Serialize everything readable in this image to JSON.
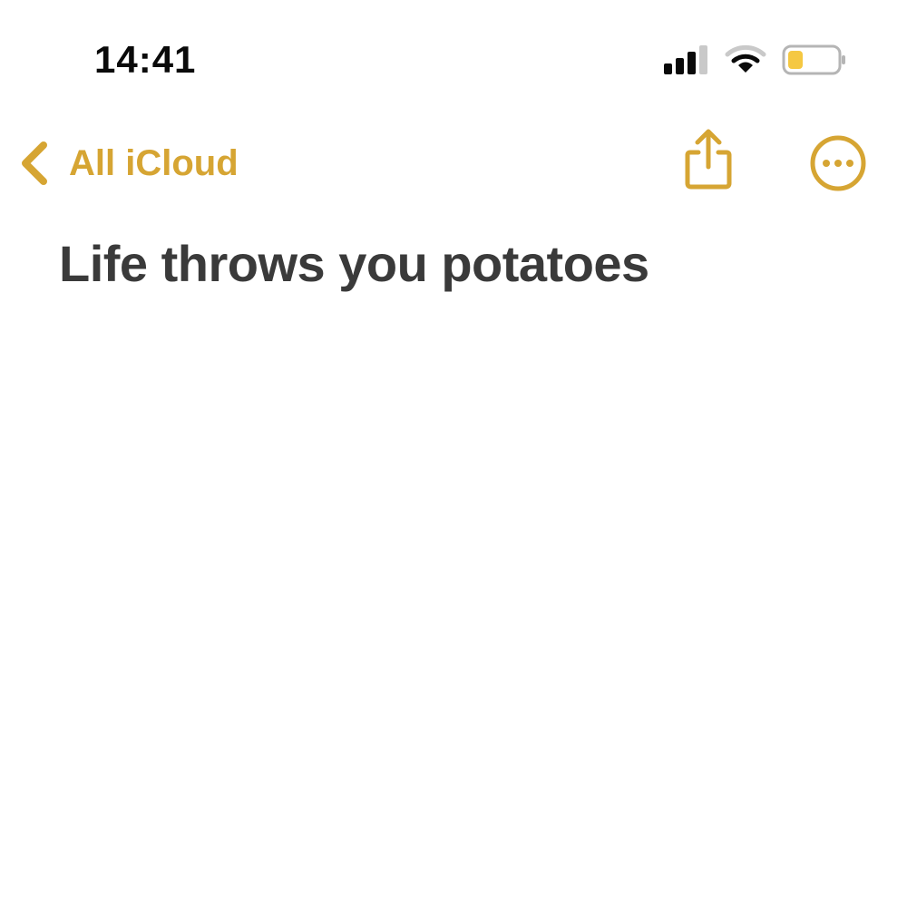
{
  "status_bar": {
    "time": "14:41",
    "signal_icon": "cellular-signal-icon",
    "wifi_icon": "wifi-icon",
    "battery_icon": "battery-low-icon",
    "battery_level": 0.3
  },
  "nav": {
    "back_label": "All iCloud",
    "back_icon": "chevron-left-icon",
    "share_icon": "share-icon",
    "more_icon": "ellipsis-circle-icon"
  },
  "note": {
    "title": "Life throws you potatoes"
  },
  "colors": {
    "accent": "#d6a533",
    "title_text": "#3a3a3a",
    "battery_fill": "#f5c842"
  }
}
